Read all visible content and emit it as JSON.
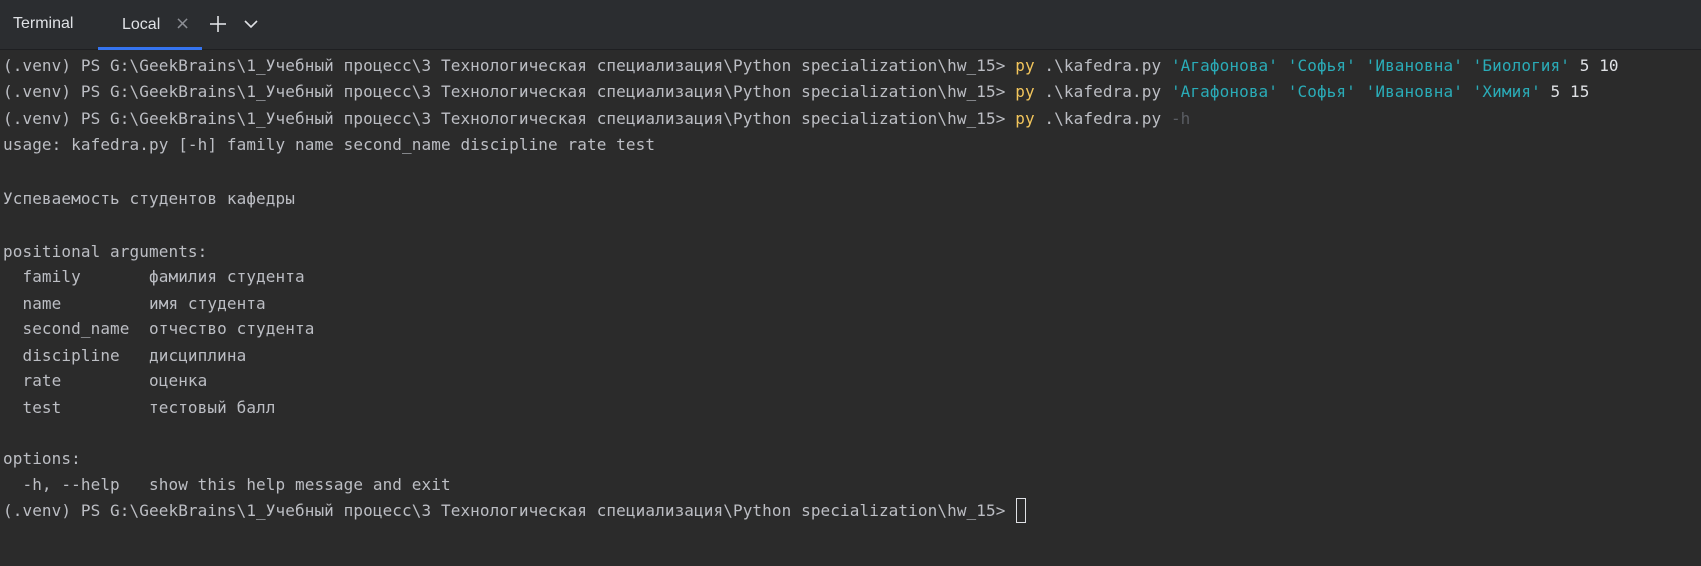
{
  "header": {
    "title": "Terminal",
    "tab_label": "Local",
    "tab_close": "×"
  },
  "terminal": {
    "prompt": "(.venv) PS G:\\GeekBrains\\1_Учебный процесс\\3 Технологическая специализация\\Python specialization\\hw_15> ",
    "cmd1": {
      "cmd": "py",
      "script": " .\\kafedra.py ",
      "args": "'Агафонова' 'Софья' 'Ивановна' 'Биология'",
      "nums": " 5 10"
    },
    "cmd2": {
      "cmd": "py",
      "script": " .\\kafedra.py ",
      "args": "'Агафонова' 'Софья' 'Ивановна' 'Химия'",
      "nums": " 5 15"
    },
    "cmd3": {
      "cmd": "py",
      "script": " .\\kafedra.py ",
      "flag": "-h"
    },
    "usage": "usage: kafedra.py [-h] family name second_name discipline rate test",
    "description": "Успеваемость студентов кафедры",
    "positional_header": "positional arguments:",
    "positional": [
      "  family       фамилия студента",
      "  name         имя студента",
      "  second_name  отчество студента",
      "  discipline   дисциплина",
      "  rate         оценка",
      "  test         тестовый балл"
    ],
    "options_header": "options:",
    "options": [
      "  -h, --help   show this help message and exit"
    ]
  },
  "colors": {
    "command": "#f2c55c",
    "string_arg": "#2aacb8",
    "accent_tab": "#3574f0"
  },
  "icons": [
    "close-icon",
    "plus-icon",
    "chevron-down-icon"
  ]
}
